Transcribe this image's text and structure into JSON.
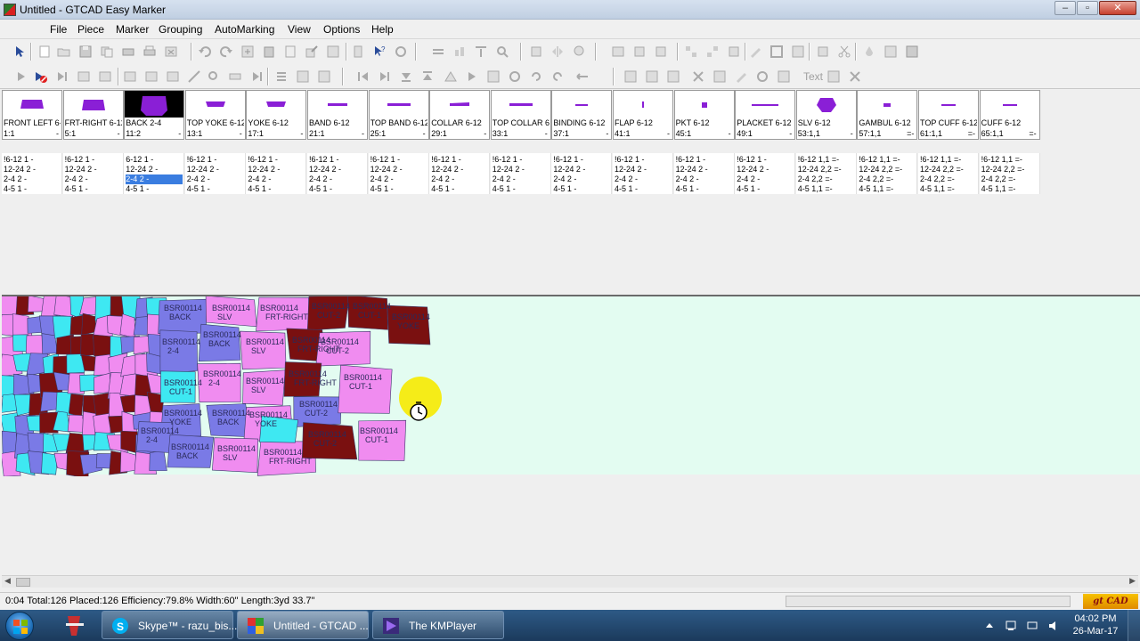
{
  "window": {
    "title": "Untitled - GTCAD Easy Marker"
  },
  "menu": [
    "File",
    "Piece",
    "Marker",
    "Grouping",
    "AutoMarking",
    "View",
    "Options",
    "Help"
  ],
  "toolbar": {
    "text_label": "Text"
  },
  "pieces": [
    {
      "name": "FRONT LEFT 6-",
      "code": "1:1",
      "dash": "-"
    },
    {
      "name": "FRT-RIGHT 6-12",
      "code": "5:1",
      "dash": "-"
    },
    {
      "name": "BACK 2-4",
      "code": "11:2",
      "dash": "-"
    },
    {
      "name": "TOP YOKE 6-12",
      "code": "13:1",
      "dash": "-"
    },
    {
      "name": "YOKE 6-12",
      "code": "17:1",
      "dash": "-"
    },
    {
      "name": "BAND 6-12",
      "code": "21:1",
      "dash": "-"
    },
    {
      "name": "TOP BAND 6-12",
      "code": "25:1",
      "dash": "-"
    },
    {
      "name": "COLLAR 6-12",
      "code": "29:1",
      "dash": "-"
    },
    {
      "name": "TOP COLLAR 6-",
      "code": "33:1",
      "dash": "-"
    },
    {
      "name": "BINDING 6-12",
      "code": "37:1",
      "dash": "-"
    },
    {
      "name": "FLAP 6-12",
      "code": "41:1",
      "dash": "-"
    },
    {
      "name": "PKT 6-12",
      "code": "45:1",
      "dash": "-"
    },
    {
      "name": "PLACKET 6-12",
      "code": "49:1",
      "dash": "-"
    },
    {
      "name": "SLV 6-12",
      "code": "53:1,1",
      "dash": "-"
    },
    {
      "name": "GAMBUL 6-12",
      "code": "57:1,1",
      "dash": "=-"
    },
    {
      "name": "TOP CUFF 6-12",
      "code": "61:1,1",
      "dash": "=-"
    },
    {
      "name": "CUFF 6-12",
      "code": "65:1,1",
      "dash": "=-"
    }
  ],
  "sizes": [
    [
      "!6-12 1  -",
      "  12-24 2  -",
      "  2-4 2  -",
      "  4-5 1  -"
    ],
    [
      "!6-12 1  -",
      "  12-24 2  -",
      "  2-4 2  -",
      "  4-5 1  -"
    ],
    [
      "  6-12 1  -",
      "  12-24 2  -",
      "  2-4 2  -",
      "  4-5 1  -"
    ],
    [
      "!6-12 1  -",
      "  12-24 2  -",
      "  2-4 2  -",
      "  4-5 1  -"
    ],
    [
      "!6-12 1  -",
      "  12-24 2  -",
      "  2-4 2  -",
      "  4-5 1  -"
    ],
    [
      "!6-12 1  -",
      "  12-24 2  -",
      "  2-4 2  -",
      "  4-5 1  -"
    ],
    [
      "!6-12 1  -",
      "  12-24 2  -",
      "  2-4 2  -",
      "  4-5 1  -"
    ],
    [
      "!6-12 1  -",
      "  12-24 2  -",
      "  2-4 2  -",
      "  4-5 1  -"
    ],
    [
      "!6-12 1  -",
      "  12-24 2  -",
      "  2-4 2  -",
      "  4-5 1  -"
    ],
    [
      "!6-12 1  -",
      "  12-24 2  -",
      "  2-4 2  -",
      "  4-5 1  -"
    ],
    [
      "!6-12 1  -",
      "  12-24 2  -",
      "  2-4 2  -",
      "  4-5 1  -"
    ],
    [
      "!6-12 1  -",
      "  12-24 2  -",
      "  2-4 2  -",
      "  4-5 1  -"
    ],
    [
      "!6-12 1  -",
      "  12-24 2  -",
      "  2-4 2  -",
      "  4-5 1  -"
    ],
    [
      "!6-12 1,1 =-",
      "  12-24 2,2 =-",
      "  2-4 2,2 =-",
      "  4-5 1,1 =-"
    ],
    [
      "!6-12 1,1 =-",
      "  12-24 2,2 =-",
      "  2-4 2,2 =-",
      "  4-5 1,1 =-"
    ],
    [
      "!6-12 1,1 =-",
      "  12-24 2,2 =-",
      "  2-4 2,2 =-",
      "  4-5 1,1 =-"
    ],
    [
      "!6-12 1,1 =-",
      "  12-24 2,2 =-",
      "  2-4 2,2 =-",
      "  4-5 1,1 =-"
    ]
  ],
  "selected_piece": 2,
  "selected_size_row": 2,
  "marker": {
    "piece_label_prefix": "BSR00114",
    "piece_labels": [
      "BACK",
      "SLV",
      "FRT-RIGHT",
      "CUT-2",
      "CUT-1",
      "YOKE",
      "2-4"
    ],
    "colors": {
      "background": "#e3fcf1",
      "magenta": "#f08cf0",
      "cyan": "#3ee8f2",
      "slate": "#7a7ae6",
      "maroon": "#7a1010"
    }
  },
  "status": {
    "text": "0:04  Total:126  Placed:126  Efficiency:79.8%  Width:60\"  Length:3yd 33.7\"",
    "brand": "gt CAD"
  },
  "taskbar": {
    "items": [
      {
        "label": "Skype™ - razu_bis...",
        "icon": "skype-icon"
      },
      {
        "label": "Untitled - GTCAD ...",
        "icon": "gtcad-icon"
      },
      {
        "label": "The KMPlayer",
        "icon": "kmplayer-icon"
      }
    ],
    "time": "04:02 PM",
    "date": "26-Mar-17"
  }
}
